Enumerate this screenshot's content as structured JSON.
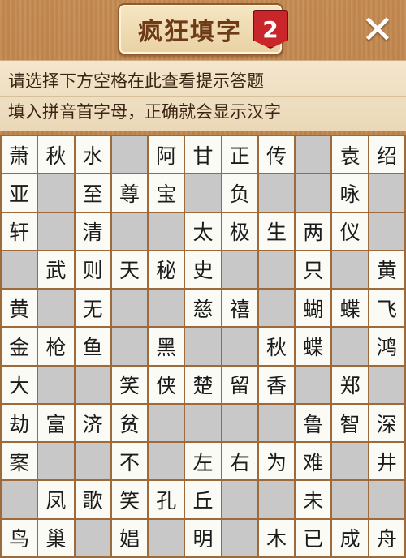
{
  "header": {
    "title": "疯狂填字",
    "badge": "2",
    "close_label": "✕"
  },
  "hint": {
    "line1": "请选择下方空格在此查看提示答题",
    "line2": "填入拼音首字母，正确就会显示汉字"
  },
  "grid": {
    "rows": [
      [
        "萧",
        "秋",
        "水",
        "",
        "阿",
        "甘",
        "正",
        "传",
        "",
        "袁",
        "绍"
      ],
      [
        "亚",
        "",
        "至",
        "尊",
        "宝",
        "",
        "负",
        "",
        "",
        "咏",
        ""
      ],
      [
        "轩",
        "",
        "清",
        "",
        "",
        "太",
        "极",
        "生",
        "两",
        "仪",
        ""
      ],
      [
        "",
        "武",
        "则",
        "天",
        "秘",
        "史",
        "",
        "",
        "只",
        "",
        "黄"
      ],
      [
        "黄",
        "",
        "无",
        "",
        "",
        "慈",
        "禧",
        "",
        "蝴",
        "蝶",
        "飞"
      ],
      [
        "金",
        "枪",
        "鱼",
        "",
        "黑",
        "",
        "",
        "秋",
        "蝶",
        "",
        "鸿"
      ],
      [
        "大",
        "",
        "",
        "笑",
        "侠",
        "楚",
        "留",
        "香",
        "",
        "郑",
        ""
      ],
      [
        "劫",
        "富",
        "济",
        "贫",
        "",
        "",
        "",
        "",
        "鲁",
        "智",
        "深"
      ],
      [
        "案",
        "",
        "",
        "不",
        "",
        "左",
        "右",
        "为",
        "难",
        "",
        "井"
      ],
      [
        "",
        "凤",
        "歌",
        "笑",
        "孔",
        "丘",
        "",
        "",
        "未",
        "",
        ""
      ],
      [
        "鸟",
        "巢",
        "",
        "娼",
        "",
        "明",
        "",
        "木",
        "已",
        "成",
        "舟"
      ]
    ]
  }
}
